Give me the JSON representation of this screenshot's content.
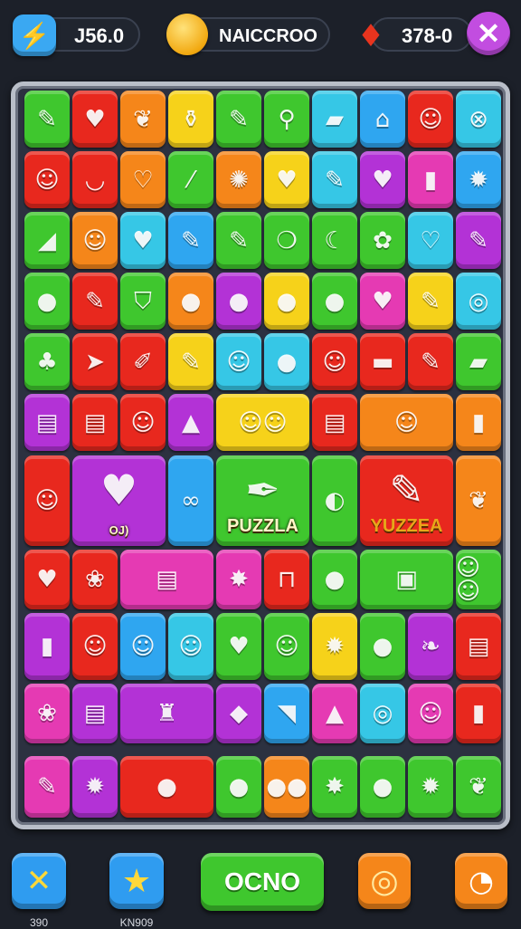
{
  "hud": {
    "boost_value": "J56.0",
    "boost_icon": "lightning-icon",
    "coins_label": "NAICCROO",
    "coin_icon": "coin-icon",
    "lives_value": "378-0",
    "lives_icon": "fire-drop-icon",
    "close_icon": "close-icon",
    "colors": {
      "accent_blue": "#3aa8f2",
      "close_purple": "#c24de0",
      "coin_gold": "#f2a911"
    }
  },
  "board": {
    "special_labels": {
      "chain": "OJ)",
      "puzzla": "PUZZLA",
      "yuzzea": "YUZZEA"
    },
    "palette": {
      "G": "#3fc72e",
      "R": "#e8281e",
      "O": "#f5861a",
      "Y": "#f6d21a",
      "B": "#2fa6f0",
      "P": "#b332d6",
      "M": "#e53ab3",
      "C": "#36c7e6"
    },
    "tiles": [
      {
        "c": "G",
        "i": "pencil-icon",
        "g": "✎"
      },
      {
        "c": "R",
        "i": "heart-icon",
        "g": "♥"
      },
      {
        "c": "O",
        "i": "leaf-icon",
        "g": "❦"
      },
      {
        "c": "Y",
        "i": "bottle-icon",
        "g": "⚱"
      },
      {
        "c": "G",
        "i": "pencil-icon",
        "g": "✎"
      },
      {
        "c": "G",
        "i": "pin-icon",
        "g": "⚲"
      },
      {
        "c": "C",
        "i": "box-icon",
        "g": "▰"
      },
      {
        "c": "B",
        "i": "gift-icon",
        "g": "⌂"
      },
      {
        "c": "R",
        "i": "lion-icon",
        "g": "☺"
      },
      {
        "c": "C",
        "i": "lifebuoy-icon",
        "g": "⊗"
      },
      {
        "c": "R",
        "i": "face-icon",
        "g": "☺"
      },
      {
        "c": "R",
        "i": "mouth-icon",
        "g": "◡"
      },
      {
        "c": "O",
        "i": "heart-icon",
        "g": "♡"
      },
      {
        "c": "G",
        "i": "feather-icon",
        "g": "⁄"
      },
      {
        "c": "O",
        "i": "splash-icon",
        "g": "✺"
      },
      {
        "c": "Y",
        "i": "heart-icon",
        "g": "♥"
      },
      {
        "c": "C",
        "i": "pencil-icon",
        "g": "✎"
      },
      {
        "c": "P",
        "i": "heart-icon",
        "g": "♥"
      },
      {
        "c": "M",
        "i": "jar-icon",
        "g": "▮"
      },
      {
        "c": "B",
        "i": "sun-icon",
        "g": "✹"
      },
      {
        "c": "G",
        "i": "crayon-icon",
        "g": "◢"
      },
      {
        "c": "O",
        "i": "face-icon",
        "g": "☺"
      },
      {
        "c": "C",
        "i": "heart-icon",
        "g": "♥"
      },
      {
        "c": "B",
        "i": "pencil-icon",
        "g": "✎"
      },
      {
        "c": "G",
        "i": "pencil-icon",
        "g": "✎"
      },
      {
        "c": "G",
        "i": "flame-icon",
        "g": "❍"
      },
      {
        "c": "G",
        "i": "moon-icon",
        "g": "☾"
      },
      {
        "c": "G",
        "i": "flower-icon",
        "g": "✿"
      },
      {
        "c": "C",
        "i": "heart-icon",
        "g": "♡"
      },
      {
        "c": "P",
        "i": "pencil-icon",
        "g": "✎"
      },
      {
        "c": "G",
        "i": "apple-icon",
        "g": "●"
      },
      {
        "c": "R",
        "i": "pencil-icon",
        "g": "✎"
      },
      {
        "c": "G",
        "i": "shield-icon",
        "g": "⛉"
      },
      {
        "c": "O",
        "i": "ball-icon",
        "g": "●"
      },
      {
        "c": "P",
        "i": "chat-icon",
        "g": "●"
      },
      {
        "c": "Y",
        "i": "apple-icon",
        "g": "●"
      },
      {
        "c": "G",
        "i": "leaf-icon",
        "g": "●"
      },
      {
        "c": "M",
        "i": "heart-icon",
        "g": "♥"
      },
      {
        "c": "Y",
        "i": "pencil-icon",
        "g": "✎"
      },
      {
        "c": "C",
        "i": "ring-icon",
        "g": "◎"
      },
      {
        "c": "G",
        "i": "tree-icon",
        "g": "♣"
      },
      {
        "c": "R",
        "i": "plane-icon",
        "g": "➤"
      },
      {
        "c": "R",
        "i": "brush-icon",
        "g": "✐"
      },
      {
        "c": "Y",
        "i": "pencil-icon",
        "g": "✎"
      },
      {
        "c": "C",
        "i": "face-icon",
        "g": "☺"
      },
      {
        "c": "C",
        "i": "apple-icon",
        "g": "●"
      },
      {
        "c": "R",
        "i": "face-icon",
        "g": "☺"
      },
      {
        "c": "R",
        "i": "marker-icon",
        "g": "▬"
      },
      {
        "c": "R",
        "i": "pencil-icon",
        "g": "✎"
      },
      {
        "c": "G",
        "i": "eraser-icon",
        "g": "▰"
      },
      {
        "c": "P",
        "i": "candy-icon",
        "g": "▤"
      },
      {
        "c": "R",
        "i": "bar-icon",
        "g": "▤"
      },
      {
        "c": "R",
        "i": "face-icon",
        "g": "☺"
      },
      {
        "c": "P",
        "i": "gem-icon",
        "g": "▲"
      },
      {
        "c": "Y",
        "i": "twins-icon",
        "g": "☺☺"
      },
      {
        "c": "R",
        "i": "drum-icon",
        "g": "▤"
      },
      {
        "c": "O",
        "i": "face-icon",
        "g": "☺"
      },
      {
        "c": "O",
        "i": "box-icon",
        "g": "▮"
      },
      {
        "c": "R",
        "i": "lion-icon",
        "g": "☺"
      },
      {
        "c": "P",
        "i": "heart-icon",
        "g": "♥"
      },
      {
        "c": "B",
        "i": "chain-icon",
        "g": "∞"
      },
      {
        "c": "G",
        "i": "pen-icon",
        "g": "✒"
      },
      {
        "c": "G",
        "i": "lemon-icon",
        "g": "◐"
      },
      {
        "c": "R",
        "i": "pencil-icon",
        "g": "✎"
      },
      {
        "c": "O",
        "i": "cabbage-icon",
        "g": "❦"
      },
      {
        "c": "R",
        "i": "heart-icon",
        "g": "♥"
      },
      {
        "c": "R",
        "i": "leaf-icon",
        "g": "❀"
      },
      {
        "c": "M",
        "i": "books-icon",
        "g": "▤"
      },
      {
        "c": "M",
        "i": "bugs-icon",
        "g": "✸"
      },
      {
        "c": "R",
        "i": "sign-icon",
        "g": "⊓"
      },
      {
        "c": "G",
        "i": "pepper-icon",
        "g": "●"
      },
      {
        "c": "G",
        "i": "machine-icon",
        "g": "▣"
      },
      {
        "c": "G",
        "i": "faces-icon",
        "g": "☺☺"
      },
      {
        "c": "P",
        "i": "cup-icon",
        "g": "▮"
      },
      {
        "c": "R",
        "i": "face-icon",
        "g": "☺"
      },
      {
        "c": "B",
        "i": "lion-icon",
        "g": "☺"
      },
      {
        "c": "C",
        "i": "cat-icon",
        "g": "☺"
      },
      {
        "c": "G",
        "i": "heart-icon",
        "g": "♥"
      },
      {
        "c": "G",
        "i": "frog-icon",
        "g": "☺"
      },
      {
        "c": "Y",
        "i": "sun-icon",
        "g": "✹"
      },
      {
        "c": "G",
        "i": "berry-icon",
        "g": "●"
      },
      {
        "c": "P",
        "i": "leaf-icon",
        "g": "❧"
      },
      {
        "c": "R",
        "i": "books-icon",
        "g": "▤"
      },
      {
        "c": "M",
        "i": "leaf-icon",
        "g": "❀"
      },
      {
        "c": "P",
        "i": "cake-icon",
        "g": "▤"
      },
      {
        "c": "P",
        "i": "lamp-icon",
        "g": "♜"
      },
      {
        "c": "P",
        "i": "gem-icon",
        "g": "◆"
      },
      {
        "c": "B",
        "i": "cone-icon",
        "g": "◥"
      },
      {
        "c": "M",
        "i": "tree-icon",
        "g": "▲"
      },
      {
        "c": "C",
        "i": "ring-icon",
        "g": "◎"
      },
      {
        "c": "M",
        "i": "face-icon",
        "g": "☺"
      },
      {
        "c": "R",
        "i": "stick-icon",
        "g": "▮"
      },
      {
        "c": "M",
        "i": "pencil-icon",
        "g": "✎"
      },
      {
        "c": "P",
        "i": "sun-icon",
        "g": "✹"
      },
      {
        "c": "R",
        "i": "bean-icon",
        "g": "●"
      },
      {
        "c": "G",
        "i": "lemon-icon",
        "g": "●"
      },
      {
        "c": "O",
        "i": "fruits-icon",
        "g": "●●"
      },
      {
        "c": "G",
        "i": "bug-icon",
        "g": "✸"
      },
      {
        "c": "G",
        "i": "lemon-icon",
        "g": "●"
      },
      {
        "c": "G",
        "i": "star-icon",
        "g": "✹"
      },
      {
        "c": "G",
        "i": "leaf-icon",
        "g": "❦"
      },
      {
        "c": "Y",
        "i": "cube-icon",
        "g": "◆"
      },
      {
        "c": "R",
        "i": "carrot-icon",
        "g": "❧"
      }
    ]
  },
  "footer": {
    "btn1_caption": "390",
    "btn1_icon": "crossed-tools-icon",
    "btn2_caption": "KN909",
    "btn2_icon": "star-icon",
    "main_button_label": "OCNO",
    "btn4_icon": "spiral-icon",
    "btn5_icon": "timer-icon"
  }
}
